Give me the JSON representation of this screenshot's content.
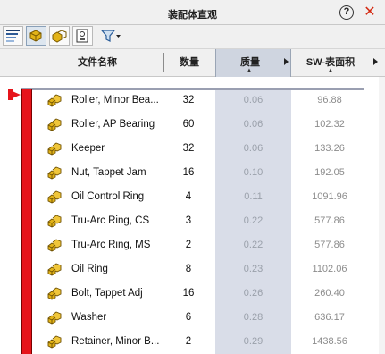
{
  "window": {
    "title": "装配体直观",
    "help_glyph": "?",
    "close_glyph": "✕"
  },
  "toolbar": {
    "buttons": [
      {
        "name": "sort-gradient-button",
        "icon": "gradient-bars-icon"
      },
      {
        "name": "part-view-button",
        "icon": "part-icon"
      },
      {
        "name": "group-view-button",
        "icon": "group-icon"
      },
      {
        "name": "property-view-button",
        "icon": "property-icon"
      },
      {
        "name": "filter-button",
        "icon": "filter-icon"
      }
    ]
  },
  "columns": {
    "name": "文件名称",
    "quantity": "数量",
    "mass": "质量",
    "area": "SW-表面积"
  },
  "rows": [
    {
      "name": "Roller, Minor Bea...",
      "qty": "32",
      "mass": "0.06",
      "area": "96.88"
    },
    {
      "name": "Roller, AP Bearing",
      "qty": "60",
      "mass": "0.06",
      "area": "102.32"
    },
    {
      "name": "Keeper",
      "qty": "32",
      "mass": "0.06",
      "area": "133.26"
    },
    {
      "name": "Nut, Tappet Jam",
      "qty": "16",
      "mass": "0.10",
      "area": "192.05"
    },
    {
      "name": "Oil Control Ring",
      "qty": "4",
      "mass": "0.11",
      "area": "1091.96"
    },
    {
      "name": "Tru-Arc Ring, CS",
      "qty": "3",
      "mass": "0.22",
      "area": "577.86"
    },
    {
      "name": "Tru-Arc Ring, MS",
      "qty": "2",
      "mass": "0.22",
      "area": "577.86"
    },
    {
      "name": "Oil Ring",
      "qty": "8",
      "mass": "0.23",
      "area": "1102.06"
    },
    {
      "name": "Bolt, Tappet Adj",
      "qty": "16",
      "mass": "0.26",
      "area": "260.40"
    },
    {
      "name": "Washer",
      "qty": "6",
      "mass": "0.28",
      "area": "636.17"
    },
    {
      "name": "Retainer, Minor B...",
      "qty": "2",
      "mass": "0.29",
      "area": "1438.56"
    }
  ],
  "colors": {
    "accent_red": "#e6141b",
    "selected_column": "#d9dde8",
    "part_icon": "#d9a514"
  }
}
